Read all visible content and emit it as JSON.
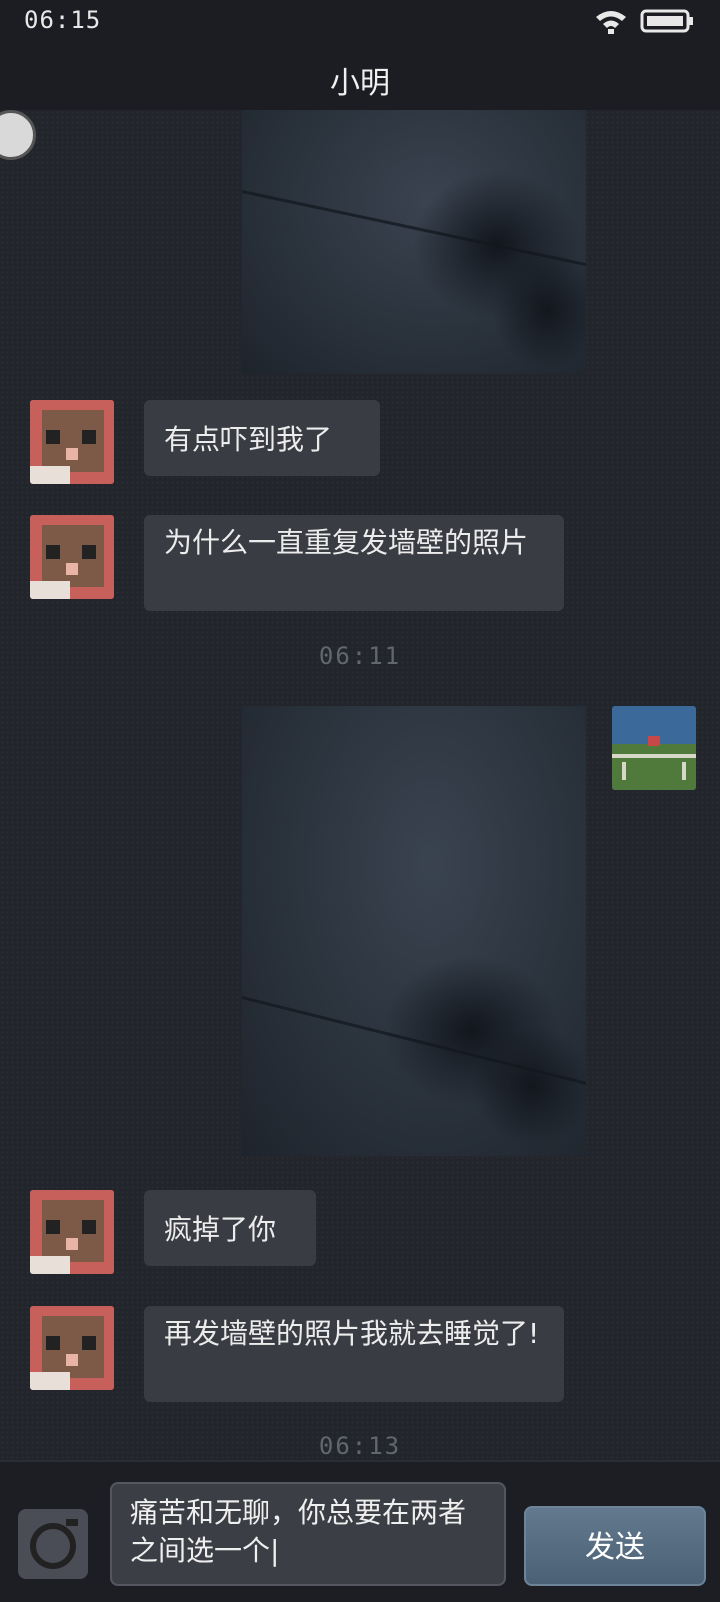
{
  "status_bar": {
    "time": "06:15",
    "wifi_icon": "wifi-icon",
    "battery_icon": "battery-icon"
  },
  "header": {
    "title": "小明"
  },
  "messages": [
    {
      "type": "image",
      "sender": "me"
    },
    {
      "type": "text",
      "sender": "other",
      "text": "有点吓到我了"
    },
    {
      "type": "text",
      "sender": "other",
      "text": "为什么一直重复发墙壁的照片"
    },
    {
      "type": "timestamp",
      "text": "06:11"
    },
    {
      "type": "image",
      "sender": "me"
    },
    {
      "type": "text",
      "sender": "other",
      "text": "疯掉了你"
    },
    {
      "type": "text",
      "sender": "other",
      "text": "再发墙壁的照片我就去睡觉了!"
    },
    {
      "type": "timestamp",
      "text": "06:13"
    }
  ],
  "input": {
    "text": "痛苦和无聊，你总要在两者之间选一个|",
    "camera_icon": "camera-icon"
  },
  "send_button": {
    "label": "发送"
  },
  "colors": {
    "bubble": "#3a3c43",
    "send": "#546c81",
    "background": "#22252b"
  }
}
